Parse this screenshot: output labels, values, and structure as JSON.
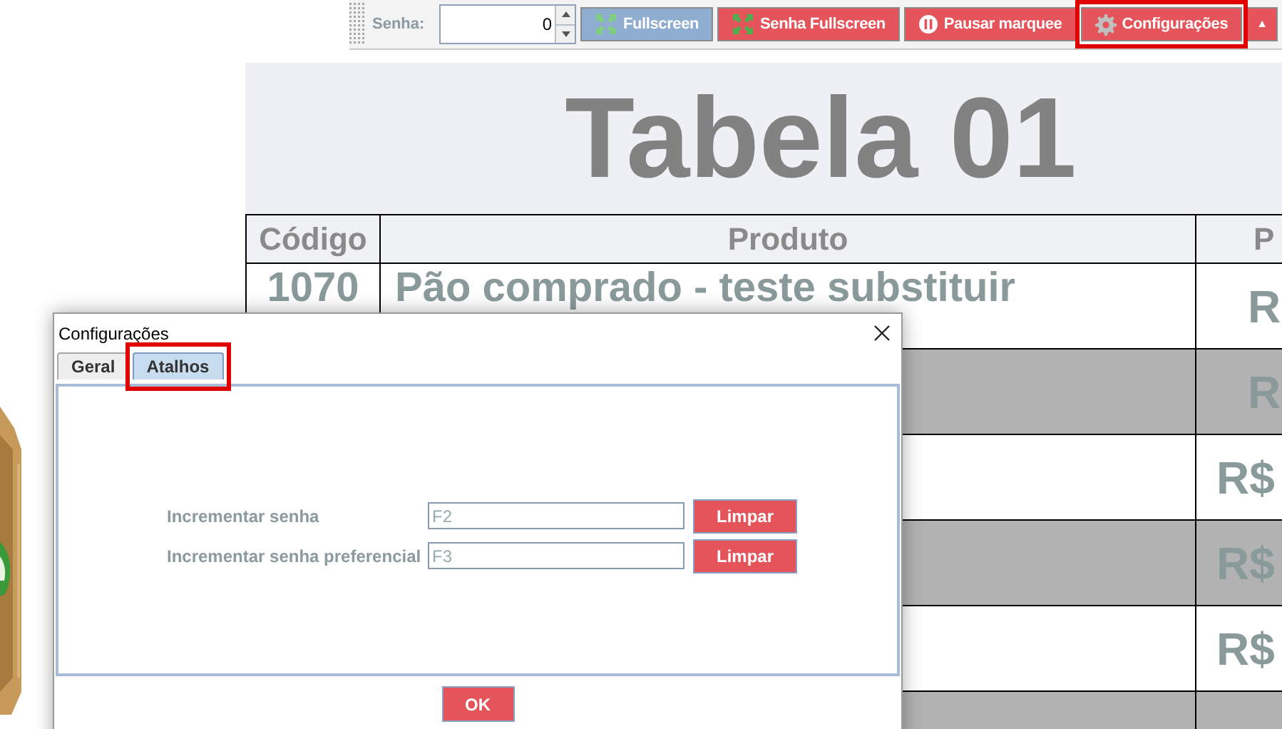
{
  "toolbar": {
    "senha_label": "Senha:",
    "senha_value": "0",
    "buttons": [
      {
        "label": "Fullscreen",
        "kind": "fullscreen",
        "disabled": true,
        "highlighted": false
      },
      {
        "label": "Senha Fullscreen",
        "kind": "fullscreen",
        "disabled": false,
        "highlighted": false
      },
      {
        "label": "Pausar marquee",
        "kind": "pause",
        "disabled": false,
        "highlighted": false
      },
      {
        "label": "Configurações",
        "kind": "settings",
        "disabled": false,
        "highlighted": true
      },
      {
        "label": "▲",
        "kind": "more",
        "disabled": false,
        "highlighted": false
      }
    ]
  },
  "title": "Tabela 01",
  "table": {
    "columns": [
      "Código",
      "Produto",
      "P"
    ],
    "rows": [
      {
        "codigo": "1070",
        "produto": "Pão comprado - teste substituir",
        "preco": "R",
        "shaded": false
      },
      {
        "preco": "R",
        "shaded": true
      },
      {
        "preco": "R$",
        "shaded": false
      },
      {
        "preco": "R$",
        "shaded": true
      },
      {
        "preco": "R$",
        "shaded": false
      },
      {
        "shaded": true
      }
    ]
  },
  "dialog": {
    "title": "Configurações",
    "tabs": [
      {
        "label": "Geral",
        "selected": false,
        "highlighted": false
      },
      {
        "label": "Atalhos",
        "selected": true,
        "highlighted": true
      }
    ],
    "shortcuts": [
      {
        "label": "Incrementar senha",
        "value": "F2",
        "button": "Limpar"
      },
      {
        "label": "Incrementar senha preferencial",
        "value": "F3",
        "button": "Limpar"
      }
    ],
    "ok": "OK"
  }
}
